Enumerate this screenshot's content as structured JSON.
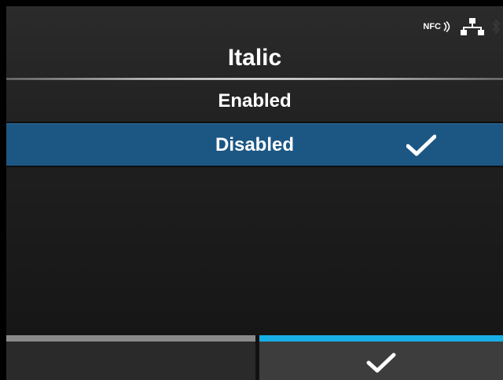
{
  "status": {
    "nfc_label": "NFC",
    "icons": [
      "nfc-icon",
      "network-icon",
      "bluetooth-icon"
    ]
  },
  "header": {
    "title": "Italic"
  },
  "options": [
    {
      "label": "Enabled",
      "selected": false
    },
    {
      "label": "Disabled",
      "selected": true
    }
  ],
  "footer": {
    "left_button": "",
    "right_button_icon": "check-icon"
  },
  "colors": {
    "selected_row": "#1c5784",
    "accent_bar": "#18aee6",
    "inactive_bar": "#8a8a8a"
  }
}
